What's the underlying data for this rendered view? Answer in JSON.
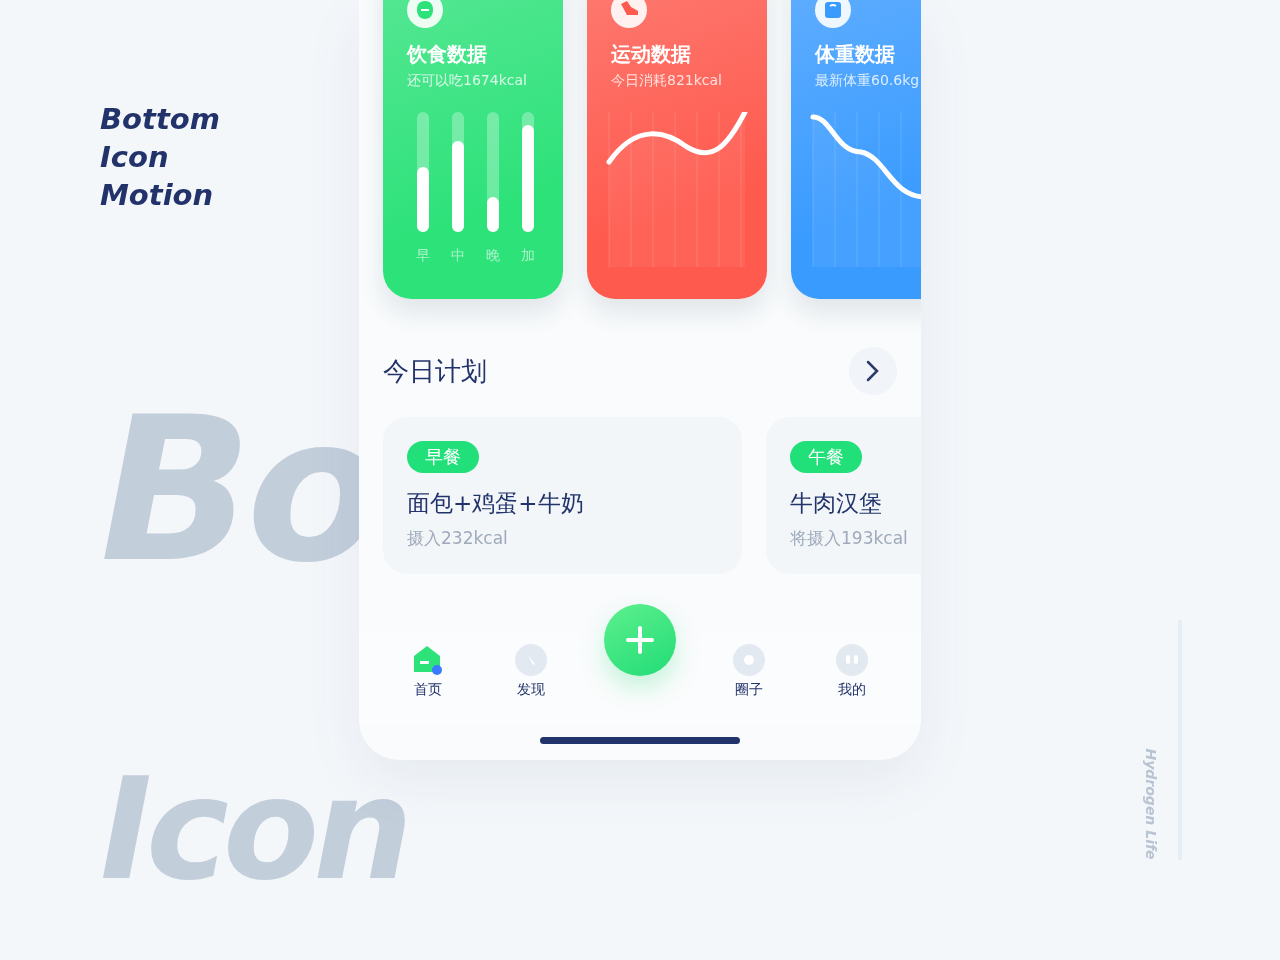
{
  "heading": [
    "Bottom",
    "Icon",
    "Motion"
  ],
  "backdrop_words": [
    "Bo",
    "Icon"
  ],
  "data_cards": [
    {
      "kind": "bars",
      "color": "#2ee27a",
      "title": "饮食数据",
      "subtitle": "还可以吃1674kcal",
      "meals": [
        {
          "label": "早",
          "level": 0.54
        },
        {
          "label": "中",
          "level": 0.76
        },
        {
          "label": "晚",
          "level": 0.29
        },
        {
          "label": "加",
          "level": 0.89
        }
      ]
    },
    {
      "kind": "rise",
      "color": "#ff5a4e",
      "title": "运动数据",
      "subtitle": "今日消耗821kcal"
    },
    {
      "kind": "fall",
      "color": "#3a9bff",
      "title": "体重数据",
      "subtitle": "最新体重60.6kg"
    }
  ],
  "plan": {
    "title": "今日计划",
    "items": [
      {
        "tag": "早餐",
        "name": "面包+鸡蛋+牛奶",
        "intake": "摄入232kcal"
      },
      {
        "tag": "午餐",
        "name": "牛肉汉堡",
        "intake": "将摄入193kcal"
      }
    ]
  },
  "tab_bar": [
    {
      "kind": "home",
      "label": "首页",
      "selected": true
    },
    {
      "kind": "compass",
      "label": "发现",
      "selected": false
    },
    {
      "kind": "add"
    },
    {
      "kind": "ring",
      "label": "圈子",
      "selected": false
    },
    {
      "kind": "face",
      "label": "我的",
      "selected": false
    }
  ],
  "side_note": "Hydrogen Life"
}
